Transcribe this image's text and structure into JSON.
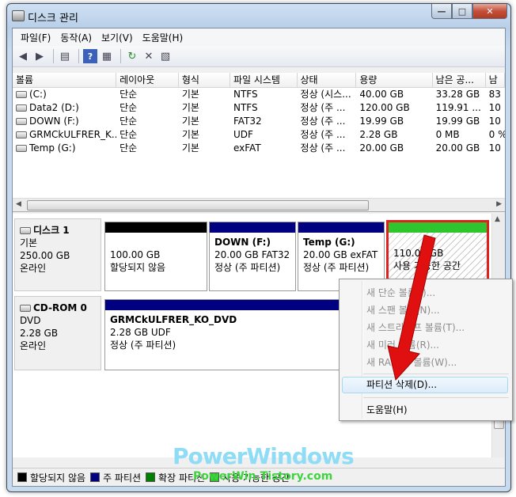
{
  "window": {
    "title": "디스크 관리"
  },
  "menu": [
    "파일(F)",
    "동작(A)",
    "보기(V)",
    "도움말(H)"
  ],
  "table": {
    "headers": [
      "볼륨",
      "레이아웃",
      "형식",
      "파일 시스템",
      "상태",
      "용량",
      "남은 공...",
      "남"
    ],
    "rows": [
      [
        "(C:)",
        "단순",
        "기본",
        "NTFS",
        "정상 (시스...",
        "40.00 GB",
        "33.28 GB",
        "83"
      ],
      [
        "Data2 (D:)",
        "단순",
        "기본",
        "NTFS",
        "정상 (주 ...",
        "120.00 GB",
        "119.91 ...",
        "10"
      ],
      [
        "DOWN (F:)",
        "단순",
        "기본",
        "FAT32",
        "정상 (주 ...",
        "19.99 GB",
        "19.99 GB",
        "10"
      ],
      [
        "GRMCkULFRER_K...",
        "단순",
        "기본",
        "UDF",
        "정상 (주 ...",
        "2.28 GB",
        "0 MB",
        "0 %"
      ],
      [
        "Temp (G:)",
        "단순",
        "기본",
        "exFAT",
        "정상 (주 ...",
        "20.00 GB",
        "20.00 GB",
        "10"
      ]
    ]
  },
  "disks": [
    {
      "name": "디스크 1",
      "type": "기본",
      "size": "250.00 GB",
      "status": "온라인",
      "partitions": [
        {
          "title": "",
          "line1": "100.00 GB",
          "line2": "할당되지 않음",
          "kind": "unalloc"
        },
        {
          "title": "DOWN  (F:)",
          "line1": "20.00 GB FAT32",
          "line2": "정상 (주 파티션)",
          "kind": "primary"
        },
        {
          "title": "Temp  (G:)",
          "line1": "20.00 GB exFAT",
          "line2": "정상 (주 파티션)",
          "kind": "primary"
        },
        {
          "title": "",
          "line1": "110.00 GB",
          "line2": "사용 가능한 공간",
          "kind": "free"
        }
      ]
    },
    {
      "name": "CD-ROM 0",
      "type": "DVD",
      "size": "2.28 GB",
      "status": "온라인",
      "partitions": [
        {
          "title": "GRMCkULFRER_KO_DVD",
          "line1": "2.28 GB UDF",
          "line2": "정상 (주 파티션)",
          "kind": "primary"
        }
      ]
    }
  ],
  "legend": [
    {
      "label": "할당되지 않음",
      "color": "#000000"
    },
    {
      "label": "주 파티션",
      "color": "#000080"
    },
    {
      "label": "확장 파티션",
      "color": "#008000"
    },
    {
      "label": "사용 가능한 공간",
      "color": "#2ec52e"
    }
  ],
  "context_menu": [
    {
      "label": "새 단순 볼륨(I)...",
      "enabled": false
    },
    {
      "label": "새 스팬 볼륨(N)...",
      "enabled": false
    },
    {
      "label": "새 스트라이프 볼륨(T)...",
      "enabled": false
    },
    {
      "label": "새 미러 볼륨(R)...",
      "enabled": false
    },
    {
      "label": "새 RAID-5 볼륨(W)...",
      "enabled": false
    },
    {
      "label": "파티션 삭제(D)...",
      "enabled": true,
      "highlighted": true
    },
    {
      "label": "도움말(H)",
      "enabled": true
    }
  ],
  "watermark": {
    "title": "PowerWindows",
    "url": "PowerWin.Tistory.com"
  },
  "colors": {
    "selection_border": "#e02020",
    "arrow": "#e01010"
  }
}
